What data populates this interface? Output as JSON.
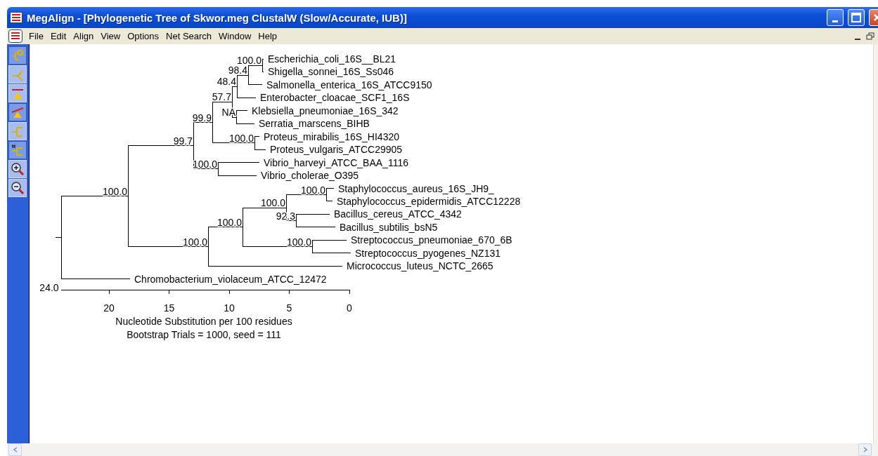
{
  "window": {
    "title": "MegAlign - [Phylogenetic Tree of Skwor.meg ClustalW (Slow/Accurate, IUB)]"
  },
  "menu": [
    "File",
    "Edit",
    "Align",
    "View",
    "Options",
    "Net Search",
    "Window",
    "Help"
  ],
  "toolbar": [
    {
      "selected": true
    },
    {
      "selected": false
    },
    {
      "selected": false
    },
    {
      "selected": true
    },
    {
      "selected": false
    },
    {
      "selected": true
    },
    {
      "selected": false
    },
    {
      "selected": false
    }
  ],
  "tree": {
    "children": [
      {
        "support": "100.0",
        "children": [
          {
            "support": "99.7",
            "children": [
              {
                "support": "99.9",
                "children": [
                  {
                    "support": "57.7",
                    "children": [
                      {
                        "support": "48.4",
                        "children": [
                          {
                            "support": "98.4",
                            "children": [
                              {
                                "support": "100.0",
                                "children": [
                                  {
                                    "name": "Escherichia_coli_16S__BL21"
                                  },
                                  {
                                    "name": "Shigella_sonnei_16S_Ss046"
                                  }
                                ]
                              },
                              {
                                "name": "Salmonella_enterica_16S_ATCC9150"
                              }
                            ]
                          },
                          {
                            "name": "Enterobacter_cloacae_SCF1_16S"
                          }
                        ]
                      },
                      {
                        "support": "NA",
                        "children": [
                          {
                            "name": "Klebsiella_pneumoniae_16S_342"
                          },
                          {
                            "name": "Serratia_marscens_BIHB"
                          }
                        ]
                      }
                    ]
                  },
                  {
                    "support": "100.0",
                    "children": [
                      {
                        "name": "Proteus_mirabilis_16S_HI4320"
                      },
                      {
                        "name": "Proteus_vulgaris_ATCC29905"
                      }
                    ]
                  }
                ]
              },
              {
                "support": "100.0",
                "children": [
                  {
                    "name": "Vibrio_harveyi_ATCC_BAA_1116"
                  },
                  {
                    "name": "Vibrio_cholerae_O395"
                  }
                ]
              }
            ]
          },
          {
            "support": "100.0",
            "children": [
              {
                "support": "100.0",
                "children": [
                  {
                    "support": "100.0",
                    "children": [
                      {
                        "support": "100.0",
                        "children": [
                          {
                            "name": "Staphylococcus_aureus_16S_JH9_"
                          },
                          {
                            "name": "Staphylococcus_epidermidis_ATCC12228"
                          }
                        ]
                      },
                      {
                        "support": "92.3",
                        "children": [
                          {
                            "name": "Bacillus_cereus_ATCC_4342"
                          },
                          {
                            "name": "Bacillus_subtilis_bsN5"
                          }
                        ]
                      }
                    ]
                  },
                  {
                    "support": "100.0",
                    "children": [
                      {
                        "name": "Streptococcus_pneumoniae_670_6B"
                      },
                      {
                        "name": "Streptococcus_pyogenes_NZ131"
                      }
                    ]
                  }
                ]
              },
              {
                "name": "Micrococcus_luteus_NCTC_2665"
              }
            ]
          }
        ]
      },
      {
        "name": "Chromobacterium_violaceum_ATCC_12472"
      }
    ]
  },
  "axis": {
    "max_label": "24.0",
    "ticks": [
      "20",
      "15",
      "10",
      "5",
      "0"
    ],
    "title": "Nucleotide Substitution per 100 residues",
    "note": "Bootstrap Trials = 1000, seed = 111"
  }
}
